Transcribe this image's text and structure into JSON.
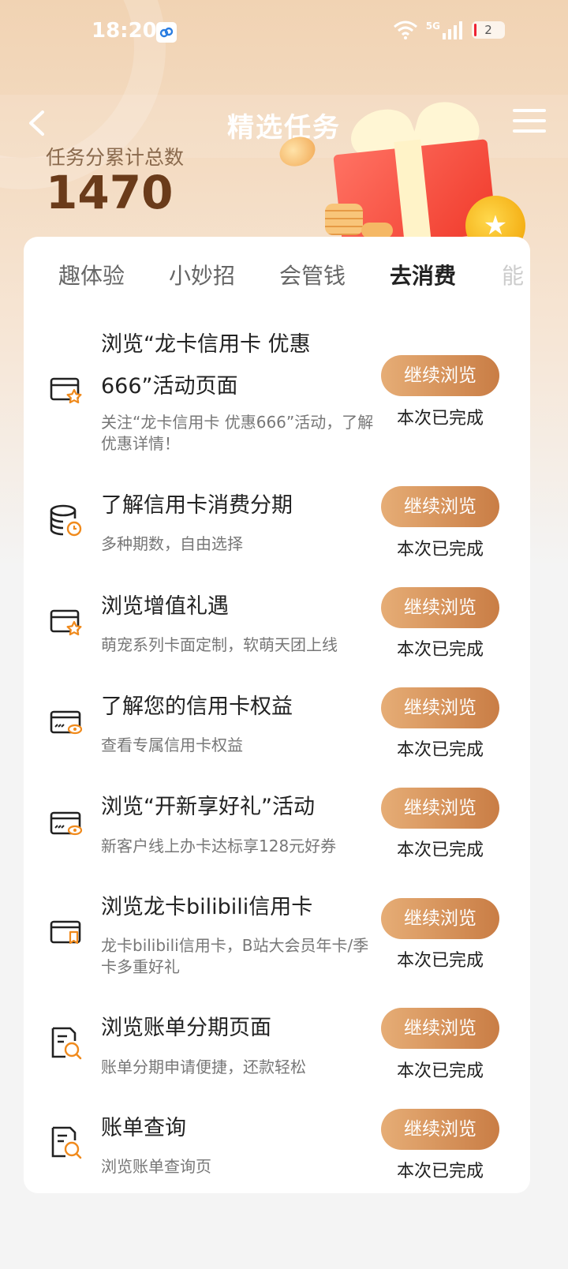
{
  "status_bar": {
    "time": "18:20",
    "network": "5G",
    "battery": "2"
  },
  "nav": {
    "title": "精选任务"
  },
  "score": {
    "label": "任务分累计总数",
    "value": "1470"
  },
  "tabs": [
    {
      "label": "趣体验"
    },
    {
      "label": "小妙招"
    },
    {
      "label": "会管钱"
    },
    {
      "label": "去消费"
    },
    {
      "label": "能"
    }
  ],
  "tasks": [
    {
      "icon": "card-star-icon",
      "title": "浏览“龙卡信用卡 优惠666”活动页面",
      "desc": "关注“龙卡信用卡 优惠666”活动，了解优惠详情！",
      "button": "继续浏览",
      "status": "本次已完成"
    },
    {
      "icon": "coins-clock-icon",
      "title": "了解信用卡消费分期",
      "desc": "多种期数，自由选择",
      "button": "继续浏览",
      "status": "本次已完成"
    },
    {
      "icon": "card-star-icon",
      "title": "浏览增值礼遇",
      "desc": "萌宠系列卡面定制，软萌天团上线",
      "button": "继续浏览",
      "status": "本次已完成"
    },
    {
      "icon": "card-eye-icon",
      "title": "了解您的信用卡权益",
      "desc": "查看专属信用卡权益",
      "button": "继续浏览",
      "status": "本次已完成"
    },
    {
      "icon": "card-eye-icon",
      "title": "浏览“开新享好礼”活动",
      "desc": "新客户线上办卡达标享128元好券",
      "button": "继续浏览",
      "status": "本次已完成"
    },
    {
      "icon": "card-bookmark-icon",
      "title": "浏览龙卡bilibili信用卡",
      "desc": "龙卡bilibili信用卡，B站大会员年卡/季卡多重好礼",
      "button": "继续浏览",
      "status": "本次已完成"
    },
    {
      "icon": "document-search-icon",
      "title": "浏览账单分期页面",
      "desc": "账单分期申请便捷，还款轻松",
      "button": "继续浏览",
      "status": "本次已完成"
    },
    {
      "icon": "document-search-icon",
      "title": "账单查询",
      "desc": "浏览账单查询页",
      "button": "继续浏览",
      "status": "本次已完成"
    }
  ]
}
